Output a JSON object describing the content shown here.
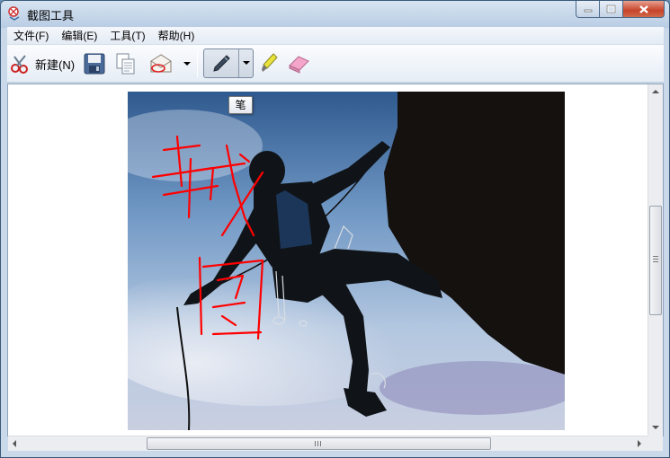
{
  "window": {
    "title": "截图工具"
  },
  "menu": [
    {
      "label": "文件(F)"
    },
    {
      "label": "编辑(E)"
    },
    {
      "label": "工具(T)"
    },
    {
      "label": "帮助(H)"
    }
  ],
  "toolbar": {
    "new_label": "新建(N)"
  },
  "tooltip": {
    "text": "笔"
  },
  "colors": {
    "ink": "#ff0000",
    "accent": "#3a5a7a"
  }
}
